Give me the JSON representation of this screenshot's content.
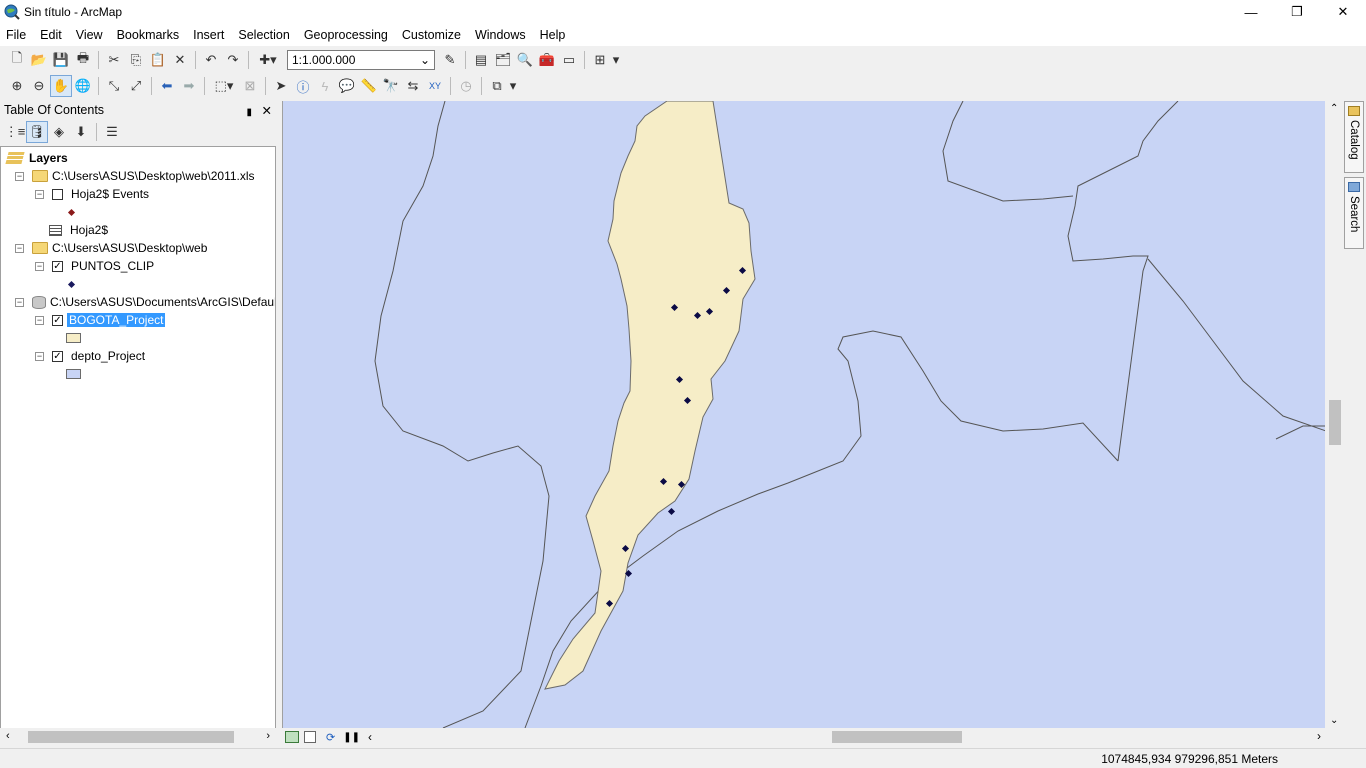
{
  "window": {
    "title": "Sin título - ArcMap",
    "controls": {
      "minimize": "—",
      "restore": "❐",
      "close": "✕"
    }
  },
  "menu": [
    "File",
    "Edit",
    "View",
    "Bookmarks",
    "Insert",
    "Selection",
    "Geoprocessing",
    "Customize",
    "Windows",
    "Help"
  ],
  "toolbar": {
    "scale": "1:1.000.000"
  },
  "toc": {
    "title": "Table Of Contents",
    "pin": "📌",
    "close": "✕",
    "root": "Layers",
    "groups": [
      {
        "path": "C:\\Users\\ASUS\\Desktop\\web\\2011.xls"
      },
      {
        "path": "C:\\Users\\ASUS\\Desktop\\web"
      },
      {
        "path": "C:\\Users\\ASUS\\Documents\\ArcGIS\\Default"
      }
    ],
    "layers": [
      {
        "name": "Hoja2$ Events",
        "checked": false,
        "symbol_color": "#8b1a1a"
      },
      {
        "name": "Hoja2$"
      },
      {
        "name": "PUNTOS_CLIP",
        "checked": true,
        "symbol_color": "#1a1a5e"
      },
      {
        "name": "BOGOTA_Project",
        "checked": true,
        "selected": true,
        "symbol_color": "#f6edc7"
      },
      {
        "name": "depto_Project",
        "checked": true,
        "symbol_color": "#c8d4f5"
      }
    ]
  },
  "side_tabs": {
    "catalog": "Catalog",
    "search": "Search"
  },
  "status": {
    "coordinates": "1074845,934  979296,851 Meters"
  },
  "colors": {
    "map_background": "#c8d4f5",
    "bogota_fill": "#f6edc7",
    "points": "#0b0b45"
  }
}
